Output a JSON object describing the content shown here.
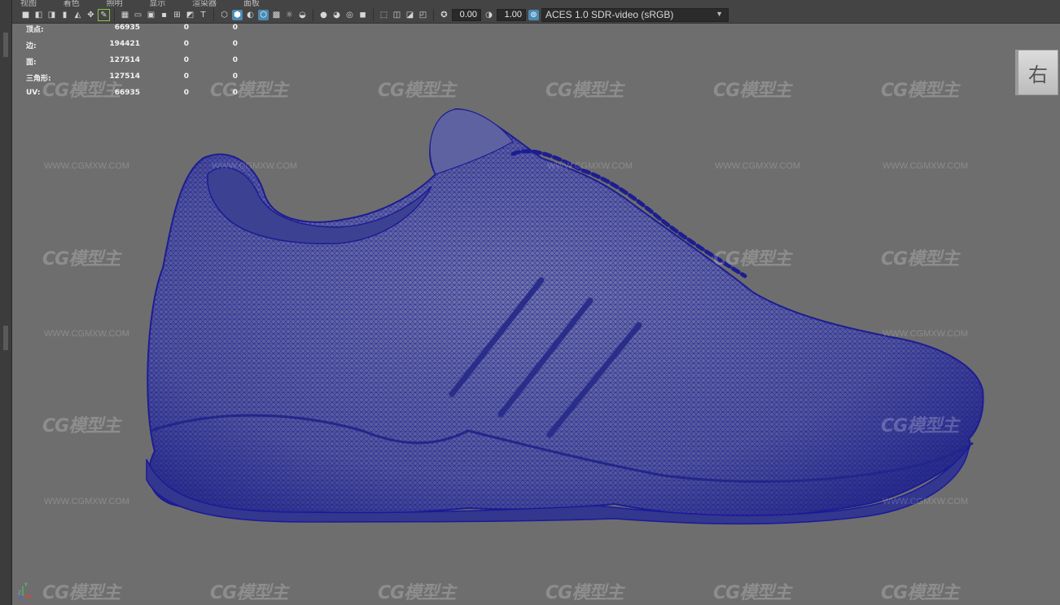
{
  "menu": {
    "items": [
      "视图",
      "着色",
      "照明",
      "显示",
      "渲染器",
      "面板"
    ]
  },
  "toolbar": {
    "exposure_value": "0.00",
    "gamma_value": "1.00",
    "color_management": {
      "selected": "ACES 1.0 SDR-video (sRGB)"
    },
    "accent_color": "#4b8ab3"
  },
  "hud_stats": {
    "rows": [
      {
        "label": "顶点:",
        "v1": "66935",
        "v2": "0",
        "v3": "0"
      },
      {
        "label": "边:",
        "v1": "194421",
        "v2": "0",
        "v3": "0"
      },
      {
        "label": "面:",
        "v1": "127514",
        "v2": "0",
        "v3": "0"
      },
      {
        "label": "三角形:",
        "v1": "127514",
        "v2": "0",
        "v3": "0"
      },
      {
        "label": "UV:",
        "v1": "66935",
        "v2": "0",
        "v3": "0"
      }
    ]
  },
  "viewcube": {
    "face_label": "右"
  },
  "watermark": {
    "logo": "CG模型主",
    "url": "WWW.CGMXW.COM"
  },
  "axis_gizmo": {
    "y": "Y",
    "z": "Z"
  },
  "viewport": {
    "background": "#6e6e6e",
    "wire_color": "#1a1a9a",
    "shade_color": "#5a5f9a"
  }
}
